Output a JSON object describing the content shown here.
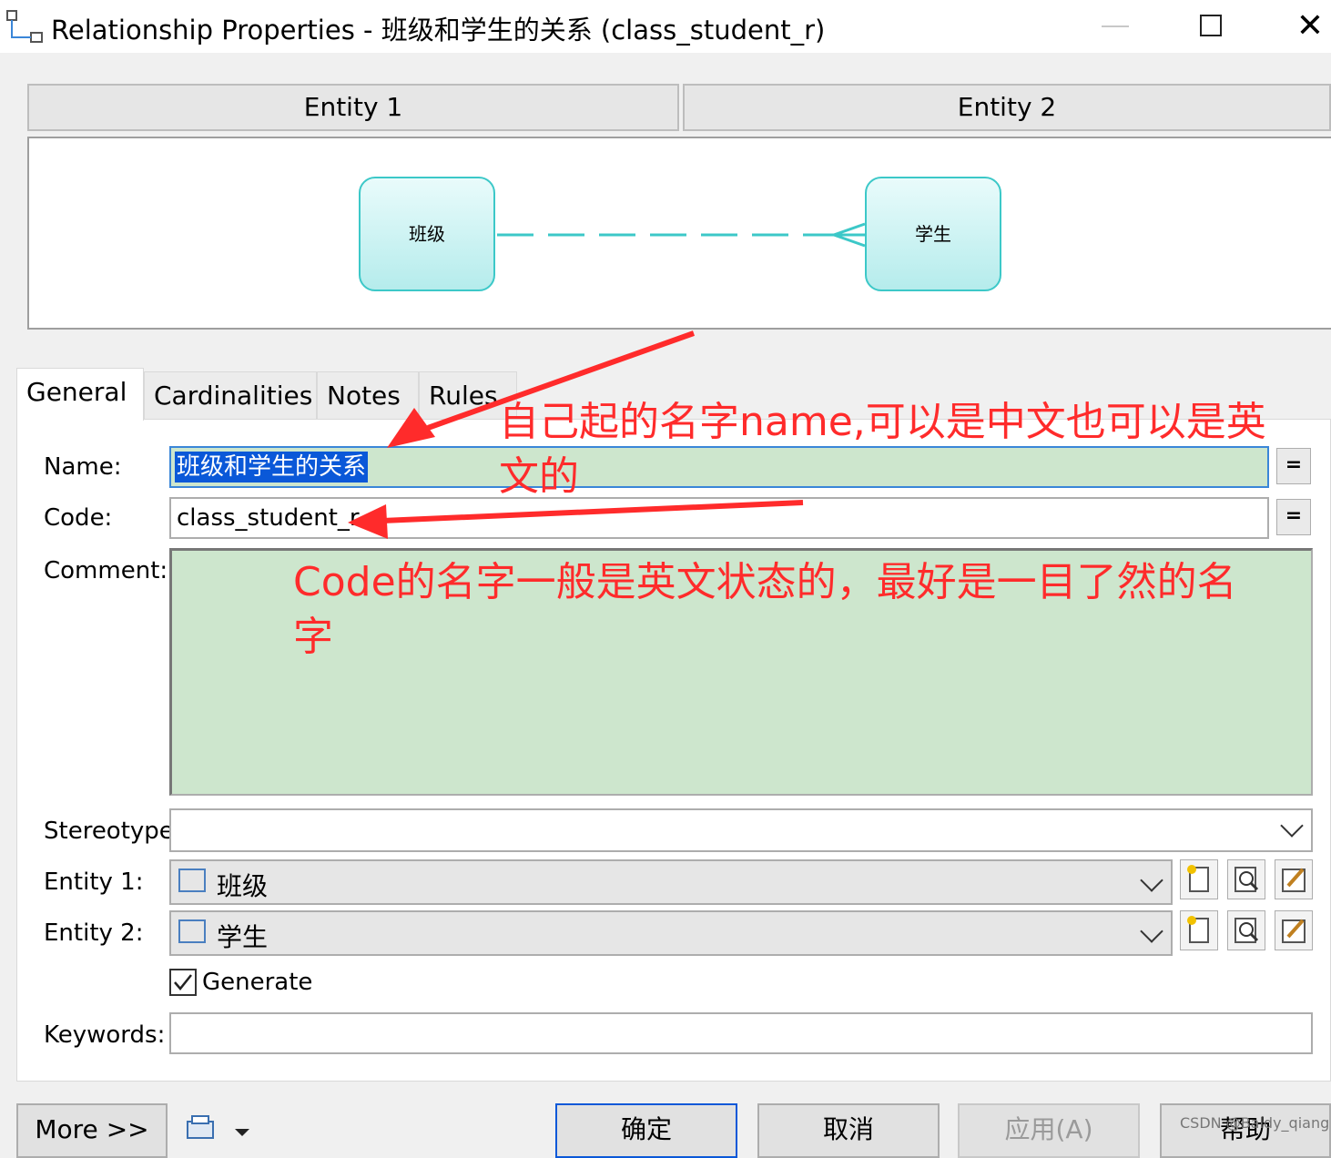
{
  "window": {
    "title": "Relationship Properties - 班级和学生的关系 (class_student_r)",
    "close_glyph": "✕"
  },
  "entity_headers": {
    "entity1": "Entity 1",
    "entity2": "Entity 2"
  },
  "diagram": {
    "entity1_name": "班级",
    "entity2_name": "学生",
    "line_color": "#3cc8c8"
  },
  "tabs": [
    "General",
    "Cardinalities",
    "Notes",
    "Rules"
  ],
  "form": {
    "name_label": "Name:",
    "name_value": "班级和学生的关系",
    "code_label": "Code:",
    "code_value": "class_student_r",
    "comment_label": "Comment:",
    "comment_value": "",
    "stereotype_label": "Stereotype:",
    "stereotype_value": "",
    "entity1_label": "Entity 1:",
    "entity1_value": "班级",
    "entity2_label": "Entity 2:",
    "entity2_value": "学生",
    "generate_label": "Generate",
    "generate_checked": true,
    "keywords_label": "Keywords:",
    "keywords_value": "",
    "eq_button": "="
  },
  "buttons": {
    "more": "More >>",
    "ok": "确定",
    "cancel": "取消",
    "apply": "应用(A)",
    "help": "帮助"
  },
  "annotations": {
    "name_note_line1": "自己起的名字name,可以是中文也可以是英",
    "name_note_line2": "文的",
    "code_note_line1": "Code的名字一般是英文状态的，最好是一目了然的名",
    "code_note_line2": "字",
    "color": "#ff2b2b"
  },
  "watermark": "CSDN @Baldy_qiang",
  "colors": {
    "field_highlight": "#cde6cd",
    "selection": "#0a58d8",
    "entity_border": "#3cc8c8"
  }
}
